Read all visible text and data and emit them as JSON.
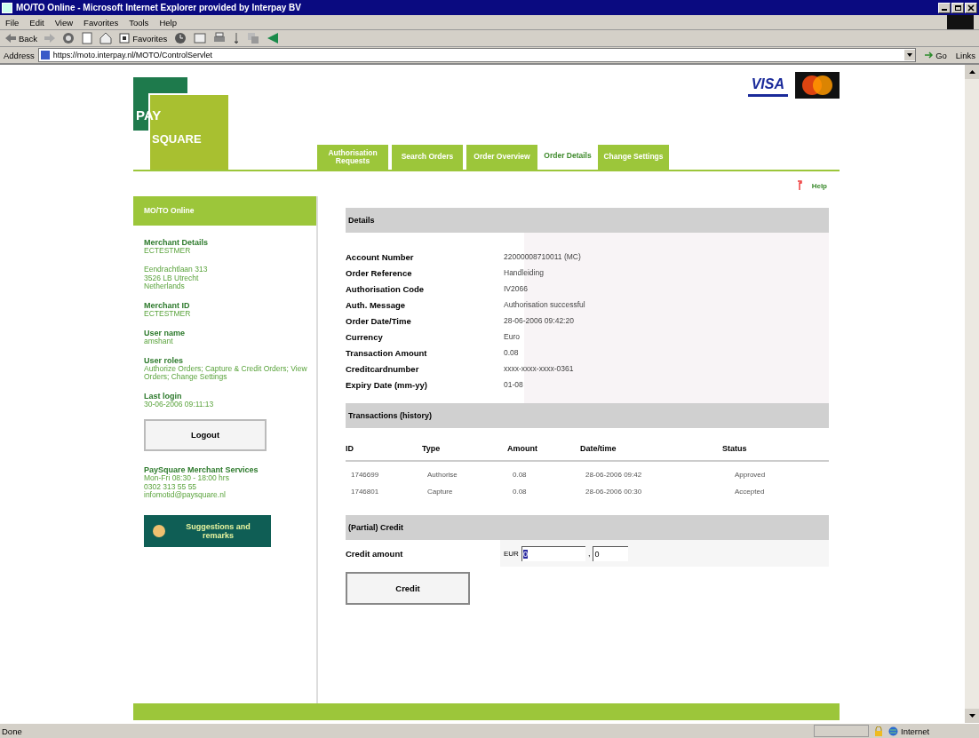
{
  "window": {
    "title": "MO/TO Online - Microsoft Internet Explorer provided by Interpay BV"
  },
  "menu": [
    "File",
    "Edit",
    "View",
    "Favorites",
    "Tools",
    "Help"
  ],
  "toolbar": {
    "back": "Back",
    "favorites": "Favorites"
  },
  "address_bar": {
    "label": "Address",
    "url": "https://moto.interpay.nl/MOTO/ControlServlet",
    "go": "Go",
    "links": "Links"
  },
  "logo": {
    "line_1": "PAY",
    "line_2": "SQUARE"
  },
  "card_logos": {
    "visa": "VISA"
  },
  "tabs": [
    {
      "label": "Authorisation Requests",
      "selected": false
    },
    {
      "label": "Search Orders",
      "selected": false
    },
    {
      "label": "Order Overview",
      "selected": false
    },
    {
      "label": "Order Details",
      "selected": true
    },
    {
      "label": "Change Settings",
      "selected": false
    }
  ],
  "help": "Help",
  "sidebar": {
    "title": "MO/TO Online",
    "sections": [
      {
        "heading": "Merchant Details",
        "lines": [
          "ECTESTMER"
        ]
      },
      {
        "lines": [
          "Eendrachtlaan 313",
          "3526 LB Utrecht",
          "Netherlands"
        ]
      },
      {
        "heading": "Merchant ID",
        "lines": [
          "ECTESTMER"
        ]
      },
      {
        "heading": "User name",
        "lines": [
          "amshant"
        ]
      },
      {
        "heading": "User roles",
        "lines": [
          "Authorize Orders; Capture & Credit Orders; View Orders; Change Settings"
        ]
      },
      {
        "heading": "Last login",
        "lines": [
          "30-06-2006 09:11:13"
        ]
      }
    ],
    "logout": "Logout",
    "contact": {
      "heading": "PaySquare Merchant Services",
      "lines": [
        "Mon-Fri 08:30 - 18:00 hrs",
        "0302 313 55 55",
        "infomotid@paysquare.nl"
      ]
    },
    "suggestions": "Suggestions and remarks"
  },
  "details": {
    "heading": "Details",
    "rows": [
      {
        "label": "Account Number",
        "value": "22000008710011 (MC)"
      },
      {
        "label": "Order Reference",
        "value": "Handleiding"
      },
      {
        "label": "Authorisation Code",
        "value": "IV2066"
      },
      {
        "label": "Auth. Message",
        "value": "Authorisation successful"
      },
      {
        "label": "Order Date/Time",
        "value": "28-06-2006 09:42:20"
      },
      {
        "label": "Currency",
        "value": "Euro"
      },
      {
        "label": "Transaction Amount",
        "value": "0.08"
      },
      {
        "label": "Creditcardnumber",
        "value": "xxxx-xxxx-xxxx-0361"
      },
      {
        "label": "Expiry Date (mm-yy)",
        "value": "01-08"
      }
    ]
  },
  "transactions": {
    "heading": "Transactions (history)",
    "columns": [
      "ID",
      "Type",
      "Amount",
      "Date/time",
      "Status"
    ],
    "rows": [
      [
        "1746699",
        "Authorise",
        "0.08",
        "28-06-2006 09:42",
        "Approved"
      ],
      [
        "1746801",
        "Capture",
        "0.08",
        "28-06-2006 00:30",
        "Accepted"
      ]
    ]
  },
  "credit": {
    "heading": "(Partial) Credit",
    "label": "Credit amount",
    "currency": "EUR",
    "whole": {
      "value": "0",
      "highlighted": true
    },
    "separator": ",",
    "cents": {
      "value": "0"
    },
    "button": "Credit"
  },
  "status_bar": {
    "text": "Done",
    "zone": "Internet"
  }
}
